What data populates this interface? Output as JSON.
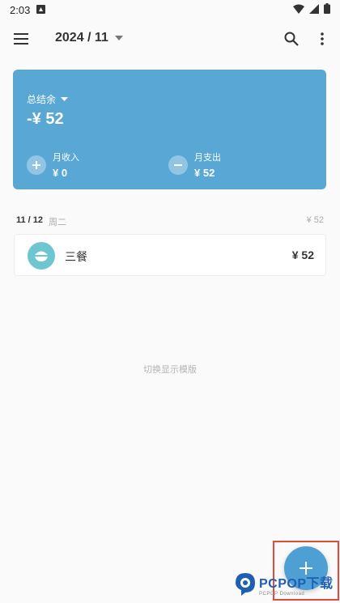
{
  "status_bar": {
    "time": "2:03"
  },
  "app_bar": {
    "month": "2024 / 11"
  },
  "balance": {
    "label": "总结余",
    "value": "-¥ 52",
    "income_label": "月收入",
    "income_value": "¥ 0",
    "expense_label": "月支出",
    "expense_value": "¥ 52"
  },
  "day_group": {
    "date": "11 / 12",
    "weekday": "周二",
    "total": "¥ 52"
  },
  "record": {
    "category": "三餐",
    "amount": "¥ 52"
  },
  "hint": "切换显示模版",
  "watermark": {
    "main": "PCPOP下载",
    "sub": "PCPOP Download"
  },
  "colors": {
    "accent": "#58a7d4",
    "fab": "#4d9fd4",
    "category_icon": "#6ec6d0",
    "highlight": "#e24b3b"
  }
}
